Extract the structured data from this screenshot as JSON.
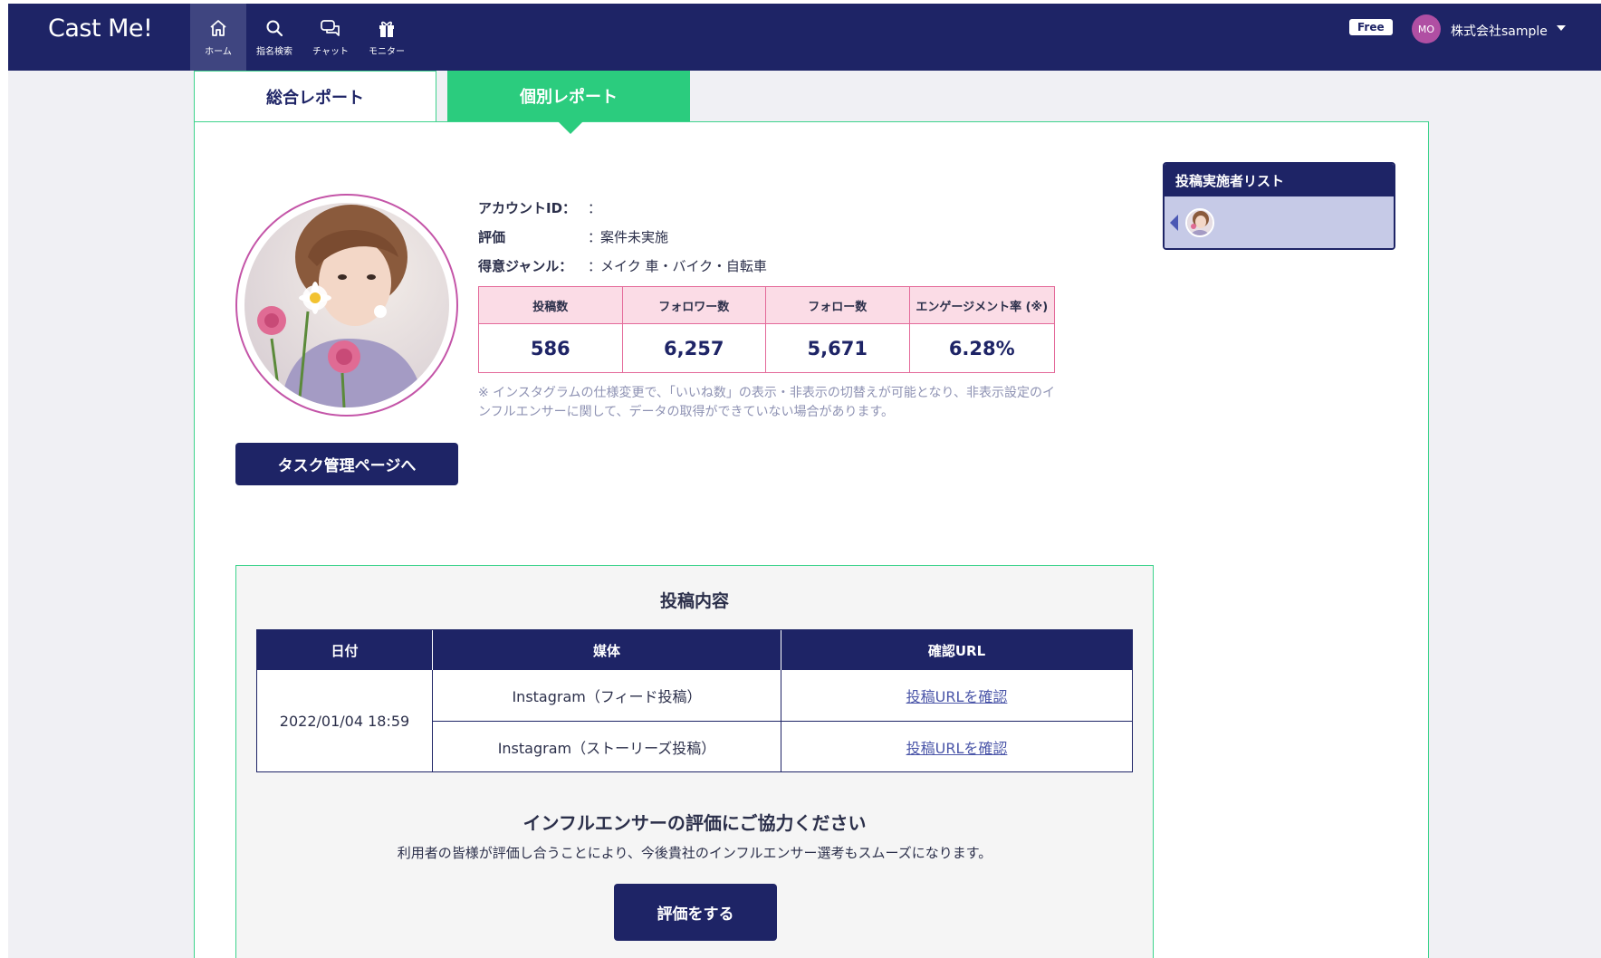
{
  "app": {
    "logo": "Cast Me!"
  },
  "nav": {
    "items": [
      {
        "label": "ホーム",
        "icon": "home-icon",
        "active": true
      },
      {
        "label": "指名検索",
        "icon": "search-icon",
        "active": false
      },
      {
        "label": "チャット",
        "icon": "chat-icon",
        "active": false
      },
      {
        "label": "モニター",
        "icon": "gift-icon",
        "active": false
      }
    ]
  },
  "user": {
    "plan": "Free",
    "initials": "MO",
    "company": "株式会社sample"
  },
  "tabs": {
    "overall": "総合レポート",
    "individual": "個別レポート",
    "active": "individual"
  },
  "profile": {
    "account_id_label": "アカウントID：",
    "account_id_value": "",
    "rating_label": "評価",
    "rating_value": "案件未実施",
    "genre_label": "得意ジャンル：",
    "genre_value": "メイク 車・バイク・自転車",
    "separator": "：",
    "task_button": "タスク管理ページへ"
  },
  "stats": {
    "headers": [
      "投稿数",
      "フォロワー数",
      "フォロー数",
      "エンゲージメント率 (※)"
    ],
    "values": [
      "586",
      "6,257",
      "5,671",
      "6.28%"
    ]
  },
  "notice": "※ インスタグラムの仕様変更で、「いいね数」の表示・非表示の切替えが可能となり、非表示設定のインフルエンサーに関して、データの取得ができていない場合があります。",
  "poster_list": {
    "title": "投稿実施者リスト"
  },
  "post_content": {
    "title": "投稿内容",
    "headers": {
      "date": "日付",
      "media": "媒体",
      "url": "確認URL"
    },
    "date": "2022/01/04 18:59",
    "rows": [
      {
        "media": "Instagram（フィード投稿）",
        "link": "投稿URLを確認"
      },
      {
        "media": "Instagram（ストーリーズ投稿）",
        "link": "投稿URLを確認"
      }
    ]
  },
  "evaluation": {
    "title": "インフルエンサーの評価にご協力ください",
    "subtitle": "利用者の皆様が評価し合うことにより、今後貴社のインフルエンサー選考もスムーズになります。",
    "button": "評価をする"
  },
  "colors": {
    "navy": "#1e2466",
    "green": "#2bcc7e",
    "pink_border": "#e46a9a",
    "pink_header": "#fbdce6"
  }
}
